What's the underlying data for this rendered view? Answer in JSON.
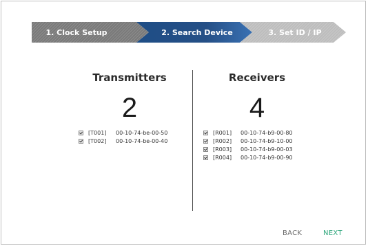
{
  "wizard": {
    "steps": [
      {
        "label": "1. Clock Setup"
      },
      {
        "label": "2. Search Device"
      },
      {
        "label": "3. Set ID / IP"
      }
    ]
  },
  "transmitters": {
    "title": "Transmitters",
    "count": "2",
    "devices": [
      {
        "id": "[T001]",
        "mac": "00-10-74-be-00-50",
        "checked": true
      },
      {
        "id": "[T002]",
        "mac": "00-10-74-be-00-40",
        "checked": true
      }
    ]
  },
  "receivers": {
    "title": "Receivers",
    "count": "4",
    "devices": [
      {
        "id": "[R001]",
        "mac": "00-10-74-b9-00-80",
        "checked": true
      },
      {
        "id": "[R002]",
        "mac": "00-10-74-b9-10-00",
        "checked": true
      },
      {
        "id": "[R003]",
        "mac": "00-10-74-b9-00-03",
        "checked": true
      },
      {
        "id": "[R004]",
        "mac": "00-10-74-b9-00-90",
        "checked": true
      }
    ]
  },
  "footer": {
    "back_label": "BACK",
    "next_label": "NEXT"
  },
  "colors": {
    "active_step": "#1f4e86",
    "next_accent": "#2aa57a",
    "back_text": "#6b6b6b"
  }
}
